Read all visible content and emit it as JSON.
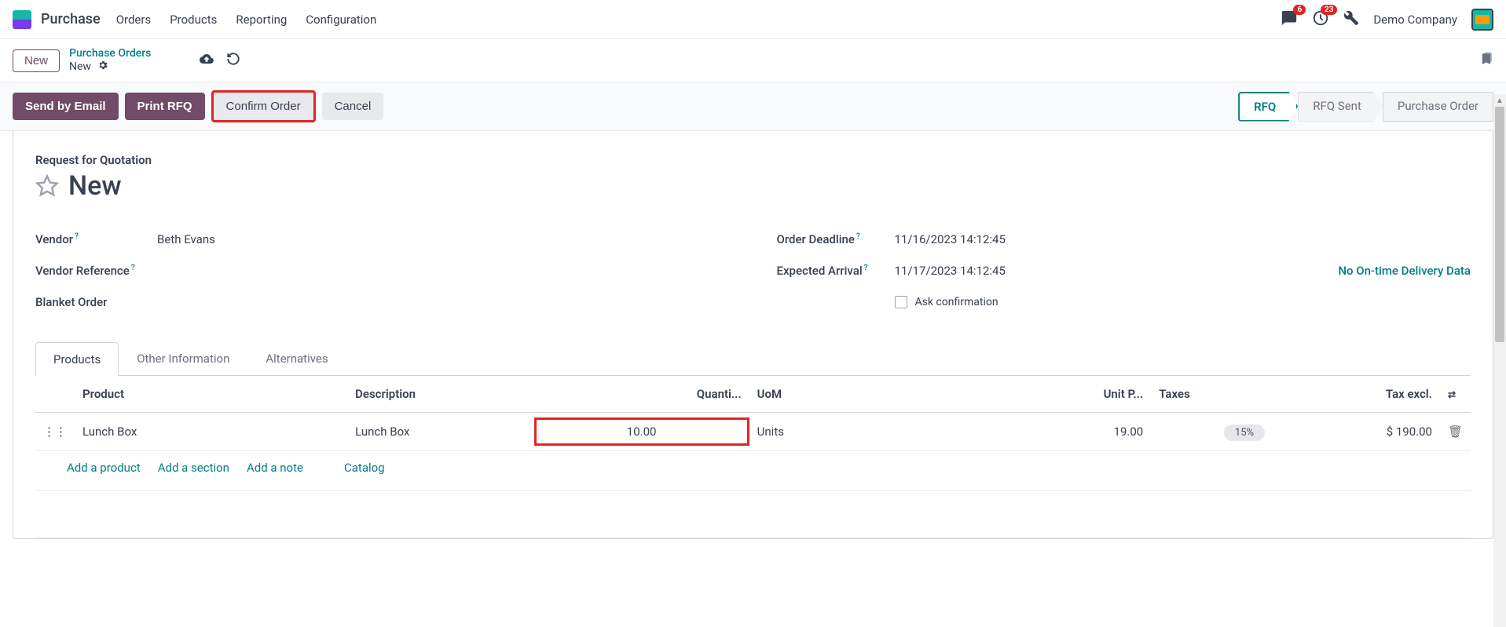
{
  "navbar": {
    "app_title": "Purchase",
    "menu": [
      "Orders",
      "Products",
      "Reporting",
      "Configuration"
    ],
    "messages_badge": "6",
    "activities_badge": "23",
    "company": "Demo Company"
  },
  "breadcrumb": {
    "new_btn": "New",
    "link": "Purchase Orders",
    "current": "New"
  },
  "actions": {
    "send_email": "Send by Email",
    "print_rfq": "Print RFQ",
    "confirm_order": "Confirm Order",
    "cancel": "Cancel"
  },
  "status_bar": {
    "rfq": "RFQ",
    "rfq_sent": "RFQ Sent",
    "purchase_order": "Purchase Order"
  },
  "sheet": {
    "subtitle": "Request for Quotation",
    "title": "New",
    "fields": {
      "vendor_label": "Vendor",
      "vendor_value": "Beth Evans",
      "vendor_ref_label": "Vendor Reference",
      "vendor_ref_value": "",
      "blanket_order_label": "Blanket Order",
      "blanket_order_value": "",
      "order_deadline_label": "Order Deadline",
      "order_deadline_value": "11/16/2023 14:12:45",
      "expected_arrival_label": "Expected Arrival",
      "expected_arrival_value": "11/17/2023 14:12:45",
      "no_delivery_data": "No On-time Delivery Data",
      "ask_confirmation_label": "Ask confirmation"
    }
  },
  "tabs": {
    "products": "Products",
    "other_info": "Other Information",
    "alternatives": "Alternatives"
  },
  "table": {
    "headers": {
      "product": "Product",
      "description": "Description",
      "quantity": "Quanti...",
      "uom": "UoM",
      "unit_price": "Unit P...",
      "taxes": "Taxes",
      "tax_excl": "Tax excl."
    },
    "rows": [
      {
        "product": "Lunch Box",
        "description": "Lunch Box",
        "quantity": "10.00",
        "uom": "Units",
        "unit_price": "19.00",
        "taxes": "15%",
        "tax_excl": "$ 190.00"
      }
    ],
    "actions": {
      "add_product": "Add a product",
      "add_section": "Add a section",
      "add_note": "Add a note",
      "catalog": "Catalog"
    }
  }
}
